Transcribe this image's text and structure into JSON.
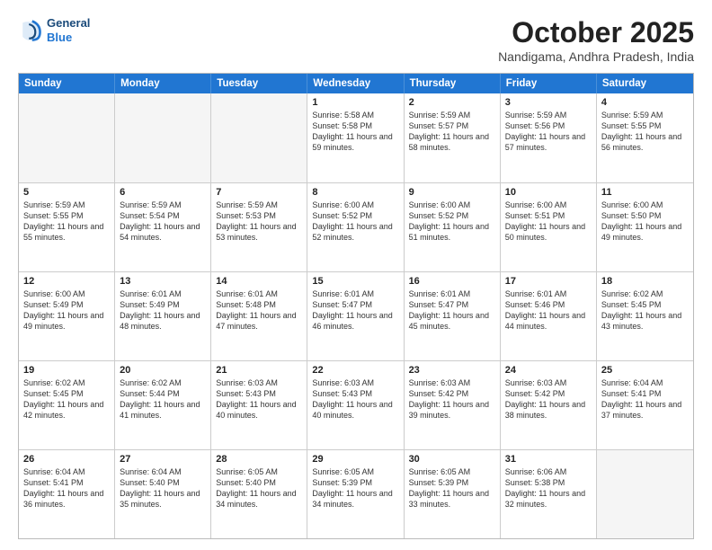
{
  "header": {
    "logo_line1": "General",
    "logo_line2": "Blue",
    "month": "October 2025",
    "location": "Nandigama, Andhra Pradesh, India"
  },
  "days_of_week": [
    "Sunday",
    "Monday",
    "Tuesday",
    "Wednesday",
    "Thursday",
    "Friday",
    "Saturday"
  ],
  "weeks": [
    [
      {
        "day": "",
        "empty": true
      },
      {
        "day": "",
        "empty": true
      },
      {
        "day": "",
        "empty": true
      },
      {
        "day": "1",
        "sunrise": "5:58 AM",
        "sunset": "5:58 PM",
        "daylight": "11 hours and 59 minutes."
      },
      {
        "day": "2",
        "sunrise": "5:59 AM",
        "sunset": "5:57 PM",
        "daylight": "11 hours and 58 minutes."
      },
      {
        "day": "3",
        "sunrise": "5:59 AM",
        "sunset": "5:56 PM",
        "daylight": "11 hours and 57 minutes."
      },
      {
        "day": "4",
        "sunrise": "5:59 AM",
        "sunset": "5:55 PM",
        "daylight": "11 hours and 56 minutes."
      }
    ],
    [
      {
        "day": "5",
        "sunrise": "5:59 AM",
        "sunset": "5:55 PM",
        "daylight": "11 hours and 55 minutes."
      },
      {
        "day": "6",
        "sunrise": "5:59 AM",
        "sunset": "5:54 PM",
        "daylight": "11 hours and 54 minutes."
      },
      {
        "day": "7",
        "sunrise": "5:59 AM",
        "sunset": "5:53 PM",
        "daylight": "11 hours and 53 minutes."
      },
      {
        "day": "8",
        "sunrise": "6:00 AM",
        "sunset": "5:52 PM",
        "daylight": "11 hours and 52 minutes."
      },
      {
        "day": "9",
        "sunrise": "6:00 AM",
        "sunset": "5:52 PM",
        "daylight": "11 hours and 51 minutes."
      },
      {
        "day": "10",
        "sunrise": "6:00 AM",
        "sunset": "5:51 PM",
        "daylight": "11 hours and 50 minutes."
      },
      {
        "day": "11",
        "sunrise": "6:00 AM",
        "sunset": "5:50 PM",
        "daylight": "11 hours and 49 minutes."
      }
    ],
    [
      {
        "day": "12",
        "sunrise": "6:00 AM",
        "sunset": "5:49 PM",
        "daylight": "11 hours and 49 minutes."
      },
      {
        "day": "13",
        "sunrise": "6:01 AM",
        "sunset": "5:49 PM",
        "daylight": "11 hours and 48 minutes."
      },
      {
        "day": "14",
        "sunrise": "6:01 AM",
        "sunset": "5:48 PM",
        "daylight": "11 hours and 47 minutes."
      },
      {
        "day": "15",
        "sunrise": "6:01 AM",
        "sunset": "5:47 PM",
        "daylight": "11 hours and 46 minutes."
      },
      {
        "day": "16",
        "sunrise": "6:01 AM",
        "sunset": "5:47 PM",
        "daylight": "11 hours and 45 minutes."
      },
      {
        "day": "17",
        "sunrise": "6:01 AM",
        "sunset": "5:46 PM",
        "daylight": "11 hours and 44 minutes."
      },
      {
        "day": "18",
        "sunrise": "6:02 AM",
        "sunset": "5:45 PM",
        "daylight": "11 hours and 43 minutes."
      }
    ],
    [
      {
        "day": "19",
        "sunrise": "6:02 AM",
        "sunset": "5:45 PM",
        "daylight": "11 hours and 42 minutes."
      },
      {
        "day": "20",
        "sunrise": "6:02 AM",
        "sunset": "5:44 PM",
        "daylight": "11 hours and 41 minutes."
      },
      {
        "day": "21",
        "sunrise": "6:03 AM",
        "sunset": "5:43 PM",
        "daylight": "11 hours and 40 minutes."
      },
      {
        "day": "22",
        "sunrise": "6:03 AM",
        "sunset": "5:43 PM",
        "daylight": "11 hours and 40 minutes."
      },
      {
        "day": "23",
        "sunrise": "6:03 AM",
        "sunset": "5:42 PM",
        "daylight": "11 hours and 39 minutes."
      },
      {
        "day": "24",
        "sunrise": "6:03 AM",
        "sunset": "5:42 PM",
        "daylight": "11 hours and 38 minutes."
      },
      {
        "day": "25",
        "sunrise": "6:04 AM",
        "sunset": "5:41 PM",
        "daylight": "11 hours and 37 minutes."
      }
    ],
    [
      {
        "day": "26",
        "sunrise": "6:04 AM",
        "sunset": "5:41 PM",
        "daylight": "11 hours and 36 minutes."
      },
      {
        "day": "27",
        "sunrise": "6:04 AM",
        "sunset": "5:40 PM",
        "daylight": "11 hours and 35 minutes."
      },
      {
        "day": "28",
        "sunrise": "6:05 AM",
        "sunset": "5:40 PM",
        "daylight": "11 hours and 34 minutes."
      },
      {
        "day": "29",
        "sunrise": "6:05 AM",
        "sunset": "5:39 PM",
        "daylight": "11 hours and 34 minutes."
      },
      {
        "day": "30",
        "sunrise": "6:05 AM",
        "sunset": "5:39 PM",
        "daylight": "11 hours and 33 minutes."
      },
      {
        "day": "31",
        "sunrise": "6:06 AM",
        "sunset": "5:38 PM",
        "daylight": "11 hours and 32 minutes."
      },
      {
        "day": "",
        "empty": true
      }
    ]
  ]
}
